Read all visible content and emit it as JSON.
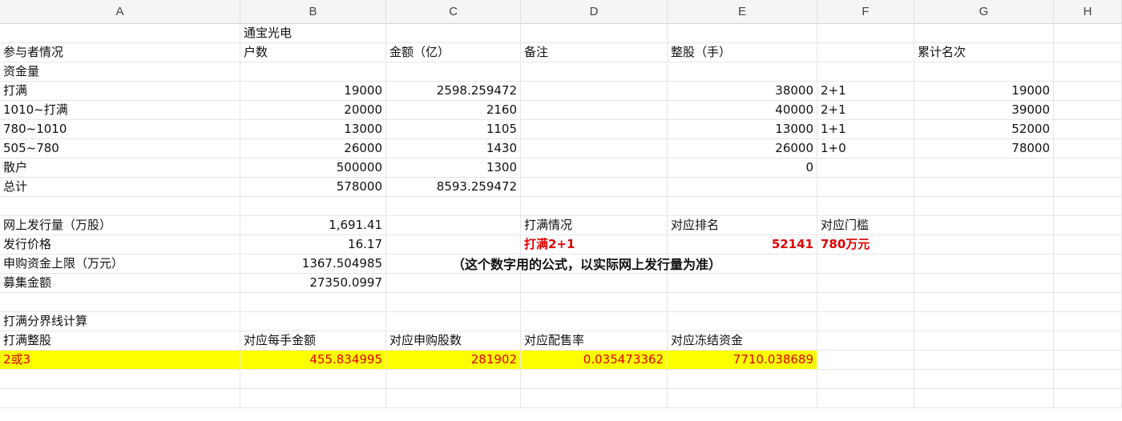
{
  "columns": [
    "A",
    "B",
    "C",
    "D",
    "E",
    "F",
    "G",
    "H"
  ],
  "rows": [
    {
      "A": "",
      "B": "通宝光电"
    },
    {
      "A": "参与者情况",
      "B": "户数",
      "C": "金额（亿）",
      "D": "备注",
      "E": "整股（手）",
      "G": "累计名次"
    },
    {
      "A": "资金量"
    },
    {
      "A": "打满",
      "B": "19000",
      "C": "2598.259472",
      "E": "38000",
      "F": "2+1",
      "G": "19000"
    },
    {
      "A": "1010~打满",
      "B": "20000",
      "C": "2160",
      "E": "40000",
      "F": "2+1",
      "G": "39000"
    },
    {
      "A": "780~1010",
      "B": "13000",
      "C": "1105",
      "E": "13000",
      "F": "1+1",
      "G": "52000"
    },
    {
      "A": "505~780",
      "B": "26000",
      "C": "1430",
      "E": "26000",
      "F": "1+0",
      "G": "78000"
    },
    {
      "A": "散户",
      "B": "500000",
      "C": "1300",
      "E": "0"
    },
    {
      "A": "总计",
      "B": "578000",
      "C": "8593.259472"
    },
    {},
    {
      "A": "网上发行量（万股）",
      "B": "1,691.41",
      "D": "打满情况",
      "E": "对应排名",
      "F": "对应门槛"
    },
    {
      "A": "发行价格",
      "B": "16.17",
      "D": "打满2+1",
      "E": "52141",
      "F": "780万元"
    },
    {
      "A": "申购资金上限（万元）",
      "B": "1367.504985"
    },
    {
      "A": "募集金额",
      "B": "27350.0997"
    },
    {},
    {
      "A": "打满分界线计算"
    },
    {
      "A": "打满整股",
      "B": "对应每手金额",
      "C": "对应申购股数",
      "D": "对应配售率",
      "E": "对应冻结资金"
    },
    {
      "A": "2或3",
      "B": "455.834995",
      "C": "281902",
      "D": "0.035473362",
      "E": "7710.038689"
    },
    {},
    {}
  ],
  "note": "（这个数字用的公式，以实际网上发行量为准）",
  "colors": {
    "highlight": "#ffff00",
    "red": "#e00000"
  }
}
